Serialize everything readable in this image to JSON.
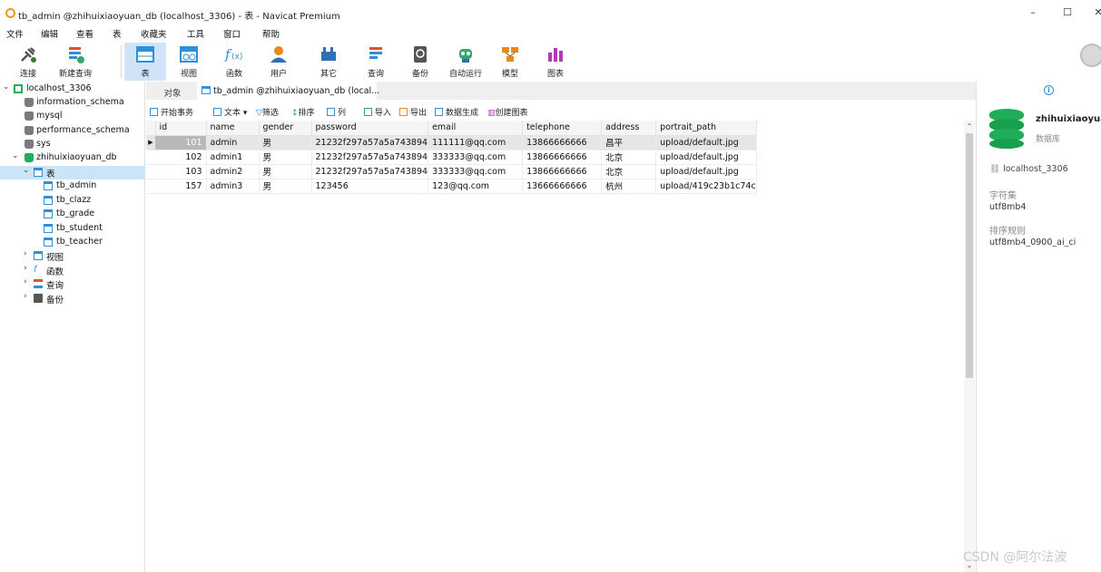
{
  "window": {
    "title": "tb_admin @zhihuixiaoyuan_db (localhost_3306) - 表 - Navicat Premium",
    "minimize": "–",
    "maximize": "☐",
    "close": "✕"
  },
  "menu": [
    "文件",
    "编辑",
    "查看",
    "表",
    "收藏夹",
    "工具",
    "窗口",
    "帮助"
  ],
  "toolbar": [
    {
      "label": "连接",
      "icon": "plug-icon",
      "color": "#3a7d2f"
    },
    {
      "label": "新建查询",
      "icon": "new-query-icon",
      "color": "#e0522a"
    },
    {
      "label": "表",
      "icon": "table-icon",
      "color": "#2f8fd8"
    },
    {
      "label": "视图",
      "icon": "view-icon",
      "color": "#2f8fd8"
    },
    {
      "label": "函数",
      "icon": "function-icon",
      "color": "#2f8fd8"
    },
    {
      "label": "用户",
      "icon": "user-icon",
      "color": "#e8891c"
    },
    {
      "label": "其它",
      "icon": "tools-icon",
      "color": "#2f6fb8"
    },
    {
      "label": "查询",
      "icon": "query-icon",
      "color": "#e0522a"
    },
    {
      "label": "备份",
      "icon": "backup-icon",
      "color": "#555555"
    },
    {
      "label": "自动运行",
      "icon": "robot-icon",
      "color": "#3aa66f"
    },
    {
      "label": "模型",
      "icon": "model-icon",
      "color": "#e8891c"
    },
    {
      "label": "图表",
      "icon": "chart-icon",
      "color": "#b23ab8"
    }
  ],
  "sidebar": {
    "connection": "localhost_3306",
    "databases": [
      "information_schema",
      "mysql",
      "performance_schema",
      "sys"
    ],
    "open_db": "zhihuixiaoyuan_db",
    "tables_node": "表",
    "tables": [
      "tb_admin",
      "tb_clazz",
      "tb_grade",
      "tb_student",
      "tb_teacher"
    ],
    "others": [
      "视图",
      "函数",
      "查询",
      "备份"
    ]
  },
  "tabs": {
    "objects": "对象",
    "active": "tb_admin @zhihuixiaoyuan_db (local..."
  },
  "subtoolbar": [
    "开始事务",
    "文本 ▾",
    "筛选",
    "排序",
    "列",
    "导入",
    "导出",
    "数据生成",
    "创建图表"
  ],
  "grid": {
    "columns": [
      "id",
      "name",
      "gender",
      "password",
      "email",
      "telephone",
      "address",
      "portrait_path"
    ],
    "rows": [
      [
        "101",
        "admin",
        "男",
        "21232f297a57a5a743894",
        "111111@qq.com",
        "13866666666",
        "昌平",
        "upload/default.jpg"
      ],
      [
        "102",
        "admin1",
        "男",
        "21232f297a57a5a743894",
        "333333@qq.com",
        "13866666666",
        "北京",
        "upload/default.jpg"
      ],
      [
        "103",
        "admin2",
        "男",
        "21232f297a57a5a743894",
        "333333@qq.com",
        "13866666666",
        "北京",
        "upload/default.jpg"
      ],
      [
        "157",
        "admin3",
        "男",
        "123456",
        "123@qq.com",
        "13666666666",
        "杭州",
        "upload/419c23b1c74c"
      ]
    ]
  },
  "info_panel": {
    "db_name": "zhihuixiaoyuan",
    "db_type": "数据库",
    "host": "localhost_3306",
    "charset_label": "字符集",
    "charset": "utf8mb4",
    "collation_label": "排序规则",
    "collation": "utf8mb4_0900_ai_ci"
  },
  "watermark": "CSDN @阿尔法波"
}
